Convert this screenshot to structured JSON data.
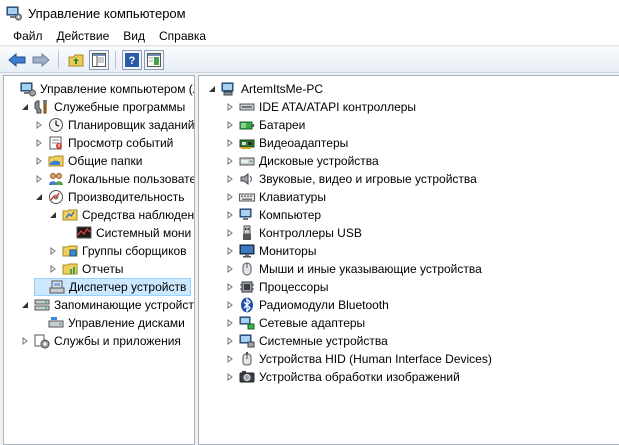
{
  "window": {
    "title": "Управление компьютером"
  },
  "menu": [
    "Файл",
    "Действие",
    "Вид",
    "Справка"
  ],
  "toolbar": {
    "icons": [
      "back-arrow-icon",
      "forward-arrow-icon",
      "up-folder-icon",
      "show-hide-tree-icon",
      "help-icon",
      "properties-icon"
    ]
  },
  "left_tree": [
    {
      "label": "Управление компьютером (л",
      "level": 0,
      "arrow": "none",
      "icon": "computer-management-icon"
    },
    {
      "label": "Служебные программы",
      "level": 1,
      "arrow": "open",
      "icon": "tools-icon"
    },
    {
      "label": "Планировщик заданий",
      "level": 2,
      "arrow": "closed",
      "icon": "clock-icon"
    },
    {
      "label": "Просмотр событий",
      "level": 2,
      "arrow": "closed",
      "icon": "event-viewer-icon"
    },
    {
      "label": "Общие папки",
      "level": 2,
      "arrow": "closed",
      "icon": "shared-folder-icon"
    },
    {
      "label": "Локальные пользовате",
      "level": 2,
      "arrow": "closed",
      "icon": "users-icon"
    },
    {
      "label": "Производительность",
      "level": 2,
      "arrow": "open",
      "icon": "performance-icon"
    },
    {
      "label": "Средства наблюдени",
      "level": 3,
      "arrow": "open",
      "icon": "monitor-tools-icon"
    },
    {
      "label": "Системный мони",
      "level": 4,
      "arrow": "none",
      "icon": "system-monitor-icon"
    },
    {
      "label": "Группы сборщиков",
      "level": 3,
      "arrow": "closed",
      "icon": "collector-folder-icon"
    },
    {
      "label": "Отчеты",
      "level": 3,
      "arrow": "closed",
      "icon": "reports-icon"
    },
    {
      "label": "Диспетчер устройств",
      "level": 2,
      "arrow": "none",
      "icon": "device-manager-icon",
      "selected": true
    },
    {
      "label": "Запоминающие устройст",
      "level": 1,
      "arrow": "open",
      "icon": "storage-icon"
    },
    {
      "label": "Управление дисками",
      "level": 2,
      "arrow": "none",
      "icon": "disk-management-icon"
    },
    {
      "label": "Службы и приложения",
      "level": 1,
      "arrow": "closed",
      "icon": "services-icon"
    }
  ],
  "right_tree": {
    "root": {
      "label": "ArtemItsMe-PC",
      "icon": "pc-icon"
    },
    "items": [
      {
        "label": "IDE ATA/ATAPI контроллеры",
        "icon": "ide-controller-icon"
      },
      {
        "label": "Батареи",
        "icon": "battery-icon"
      },
      {
        "label": "Видеоадаптеры",
        "icon": "display-adapter-icon"
      },
      {
        "label": "Дисковые устройства",
        "icon": "disk-drive-icon"
      },
      {
        "label": "Звуковые, видео и игровые устройства",
        "icon": "sound-icon"
      },
      {
        "label": "Клавиатуры",
        "icon": "keyboard-icon"
      },
      {
        "label": "Компьютер",
        "icon": "computer-icon"
      },
      {
        "label": "Контроллеры USB",
        "icon": "usb-icon"
      },
      {
        "label": "Мониторы",
        "icon": "monitor-icon"
      },
      {
        "label": "Мыши и иные указывающие устройства",
        "icon": "mouse-icon"
      },
      {
        "label": "Процессоры",
        "icon": "processor-icon"
      },
      {
        "label": "Радиомодули Bluetooth",
        "icon": "bluetooth-icon"
      },
      {
        "label": "Сетевые адаптеры",
        "icon": "network-adapter-icon"
      },
      {
        "label": "Системные устройства",
        "icon": "system-devices-icon"
      },
      {
        "label": "Устройства HID (Human Interface Devices)",
        "icon": "hid-icon"
      },
      {
        "label": "Устройства обработки изображений",
        "icon": "imaging-icon"
      }
    ]
  }
}
